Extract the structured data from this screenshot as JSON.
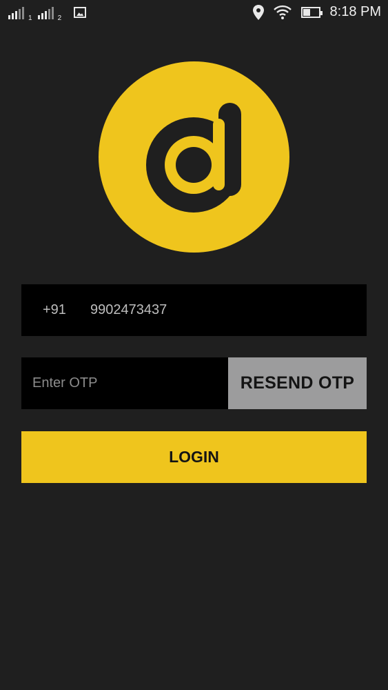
{
  "status_bar": {
    "sim1": "1",
    "sim2": "2",
    "time": "8:18 PM",
    "battery_level": 0.45,
    "icons": [
      "signal-icon",
      "signal-icon",
      "image-notification-icon",
      "location-icon",
      "wifi-icon",
      "battery-icon"
    ]
  },
  "logo": {
    "accent": "#efc51d",
    "background": "#1f1f1f",
    "icon": "d-letter-logo"
  },
  "phone": {
    "country_code": "+91",
    "number": "9902473437"
  },
  "otp": {
    "placeholder": "Enter OTP",
    "value": ""
  },
  "buttons": {
    "resend_label": "RESEND OTP",
    "login_label": "LOGIN"
  },
  "colors": {
    "accent": "#efc51d",
    "field_bg": "#000000",
    "resend_bg": "#9c9c9d",
    "page_bg": "#1f1f1f"
  }
}
